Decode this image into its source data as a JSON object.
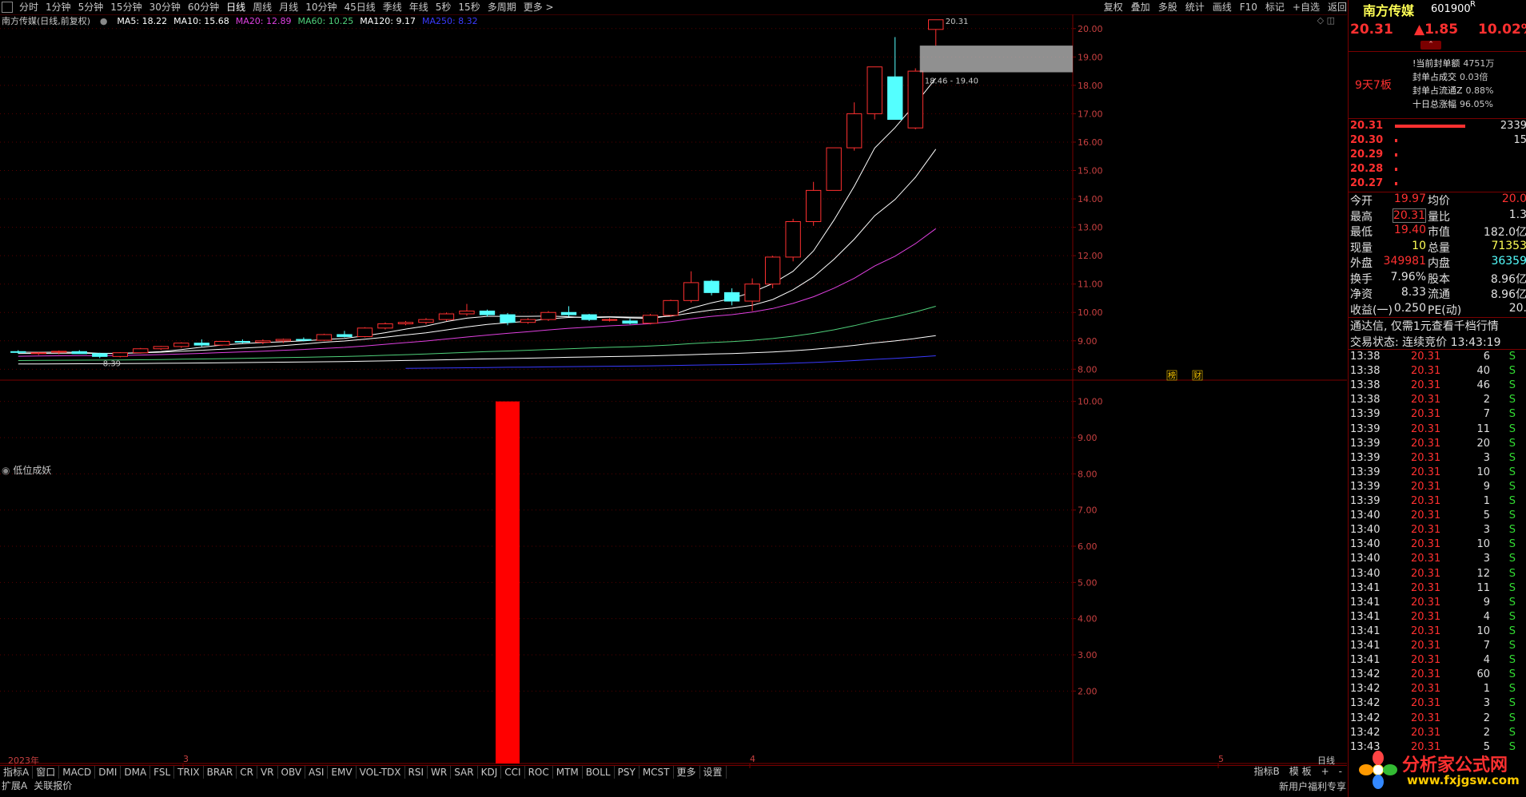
{
  "toolbar": {
    "periods": [
      "分时",
      "1分钟",
      "5分钟",
      "15分钟",
      "30分钟",
      "60分钟",
      "日线",
      "周线",
      "月线",
      "10分钟",
      "45日线",
      "季线",
      "年线",
      "5秒",
      "15秒",
      "多周期",
      "更多 >"
    ],
    "tools": [
      "复权",
      "叠加",
      "多股",
      "统计",
      "画线",
      "F10",
      "标记",
      "+自选",
      "返回"
    ]
  },
  "chart_header": {
    "title": "南方传媒(日线,前复权)",
    "ma": [
      {
        "label": "MA5: 18.22",
        "color": "#ffffff"
      },
      {
        "label": "MA10: 15.68",
        "color": "#ffffff"
      },
      {
        "label": "MA20: 12.89",
        "color": "#e040e0"
      },
      {
        "label": "MA60: 10.25",
        "color": "#4fd07a"
      },
      {
        "label": "MA120: 9.17",
        "color": "#ffffff"
      },
      {
        "label": "MA250: 8.32",
        "color": "#3a3aff"
      }
    ]
  },
  "chart_data": [
    {
      "type": "candlestick",
      "title": "南方传媒(日线,前复权)",
      "ylim": [
        7.7,
        20.5
      ],
      "yticks": [
        "20.00",
        "19.00",
        "18.00",
        "17.00",
        "16.00",
        "15.00",
        "14.00",
        "13.00",
        "12.00",
        "11.00",
        "10.00",
        "9.00",
        "8.00"
      ],
      "ohlc": [
        [
          8.62,
          8.67,
          8.55,
          8.6
        ],
        [
          8.55,
          8.6,
          8.5,
          8.58
        ],
        [
          8.6,
          8.66,
          8.52,
          8.63
        ],
        [
          8.62,
          8.67,
          8.55,
          8.55
        ],
        [
          8.55,
          8.58,
          8.39,
          8.45
        ],
        [
          8.45,
          8.6,
          8.42,
          8.58
        ],
        [
          8.58,
          8.75,
          8.55,
          8.72
        ],
        [
          8.72,
          8.82,
          8.68,
          8.8
        ],
        [
          8.8,
          8.95,
          8.75,
          8.92
        ],
        [
          8.92,
          9.05,
          8.8,
          8.85
        ],
        [
          8.85,
          9.0,
          8.82,
          8.98
        ],
        [
          8.98,
          9.05,
          8.9,
          8.95
        ],
        [
          8.95,
          9.05,
          8.88,
          9.0
        ],
        [
          9.0,
          9.08,
          8.92,
          9.05
        ],
        [
          9.05,
          9.12,
          8.98,
          9.02
        ],
        [
          9.02,
          9.25,
          9.0,
          9.22
        ],
        [
          9.22,
          9.35,
          9.12,
          9.15
        ],
        [
          9.15,
          9.48,
          9.12,
          9.45
        ],
        [
          9.45,
          9.65,
          9.4,
          9.6
        ],
        [
          9.6,
          9.7,
          9.55,
          9.65
        ],
        [
          9.65,
          9.8,
          9.58,
          9.75
        ],
        [
          9.75,
          10.0,
          9.7,
          9.95
        ],
        [
          9.95,
          10.3,
          9.88,
          10.05
        ],
        [
          10.05,
          10.1,
          9.85,
          9.92
        ],
        [
          9.92,
          9.98,
          9.55,
          9.65
        ],
        [
          9.65,
          9.8,
          9.6,
          9.75
        ],
        [
          9.75,
          10.05,
          9.7,
          10.0
        ],
        [
          10.0,
          10.22,
          9.85,
          9.92
        ],
        [
          9.92,
          9.95,
          9.7,
          9.75
        ],
        [
          9.75,
          9.8,
          9.68,
          9.75
        ],
        [
          9.7,
          9.78,
          9.58,
          9.62
        ],
        [
          9.62,
          9.95,
          9.58,
          9.9
        ],
        [
          9.9,
          10.45,
          9.85,
          10.42
        ],
        [
          10.42,
          11.45,
          10.35,
          11.05
        ],
        [
          11.1,
          11.15,
          10.6,
          10.7
        ],
        [
          10.7,
          10.85,
          10.25,
          10.4
        ],
        [
          10.4,
          11.2,
          10.05,
          11.0
        ],
        [
          11.0,
          12.0,
          10.85,
          11.95
        ],
        [
          11.95,
          13.3,
          11.8,
          13.2
        ],
        [
          13.2,
          14.6,
          13.05,
          14.3
        ],
        [
          14.3,
          15.8,
          14.3,
          15.8
        ],
        [
          15.8,
          17.4,
          15.7,
          17.0
        ],
        [
          17.0,
          18.65,
          16.8,
          18.65
        ],
        [
          18.3,
          19.7,
          16.8,
          16.8
        ],
        [
          16.5,
          18.6,
          16.45,
          18.5
        ],
        [
          19.97,
          20.31,
          19.4,
          20.31
        ]
      ],
      "annotations": [
        "8.39",
        "20.31",
        "18.46 - 19.40"
      ],
      "markers": [
        "榜",
        "财"
      ]
    },
    {
      "type": "bar",
      "title": "低位成妖",
      "ylim": [
        0,
        10.5
      ],
      "yticks": [
        "10.00",
        "9.00",
        "8.00",
        "7.00",
        "6.00",
        "5.00",
        "4.00",
        "3.00",
        "2.00"
      ],
      "signal_index": 24,
      "signal_value": 10,
      "color": "#ff0000"
    }
  ],
  "indicator_title": "低位成妖",
  "xaxis": {
    "year": "2023年",
    "m3": "3",
    "m4": "4",
    "m5": "5",
    "period": "日线"
  },
  "rpanel": {
    "name": "南方传媒",
    "code": "601900",
    "r": "R",
    "price": "20.31",
    "change": "▲1.85",
    "pct": "10.02%",
    "board": "9天7板",
    "seal": [
      {
        "k": "!当前封单额",
        "v": "4751万"
      },
      {
        "k": "封单占成交",
        "v": "0.03倍"
      },
      {
        "k": "封单占流通Z",
        "v": "0.88%"
      },
      {
        "k": "十日总涨幅",
        "v": "96.05%"
      }
    ],
    "asks": [
      {
        "p": "20.31",
        "v": "2339",
        "bar": true
      },
      {
        "p": "20.30",
        "v": "15"
      },
      {
        "p": "20.29",
        "v": ""
      },
      {
        "p": "20.28",
        "v": ""
      },
      {
        "p": "20.27",
        "v": ""
      }
    ],
    "quote": [
      {
        "l1": "今开",
        "v1": "19.97",
        "l2": "均价",
        "v2": "20.0"
      },
      {
        "l1": "最高",
        "v1": "20.31",
        "l2": "量比",
        "v2": "1.3"
      },
      {
        "l1": "最低",
        "v1": "19.40",
        "l2": "市值",
        "v2": "182.0亿"
      },
      {
        "l1": "现量",
        "v1": "10",
        "l2": "总量",
        "v2": "71353"
      },
      {
        "l1": "外盘",
        "v1": "349981",
        "l2": "内盘",
        "v2": "36359"
      },
      {
        "l1": "换手",
        "v1": "7.96%",
        "l2": "股本",
        "v2": "8.96亿"
      },
      {
        "l1": "净资",
        "v1": "8.33",
        "l2": "流通",
        "v2": "8.96亿"
      },
      {
        "l1": "收益(一)",
        "v1": "0.250",
        "l2": "PE(动)",
        "v2": "20."
      }
    ],
    "promo": "通达信, 仅需1元查看千档行情",
    "trade_state": "交易状态: 连续竞价 13:43:19",
    "ticks": [
      [
        "13:38",
        "20.31",
        "6"
      ],
      [
        "13:38",
        "20.31",
        "40"
      ],
      [
        "13:38",
        "20.31",
        "46"
      ],
      [
        "13:38",
        "20.31",
        "2"
      ],
      [
        "13:39",
        "20.31",
        "7"
      ],
      [
        "13:39",
        "20.31",
        "11"
      ],
      [
        "13:39",
        "20.31",
        "20"
      ],
      [
        "13:39",
        "20.31",
        "3"
      ],
      [
        "13:39",
        "20.31",
        "10"
      ],
      [
        "13:39",
        "20.31",
        "9"
      ],
      [
        "13:39",
        "20.31",
        "1"
      ],
      [
        "13:40",
        "20.31",
        "5"
      ],
      [
        "13:40",
        "20.31",
        "3"
      ],
      [
        "13:40",
        "20.31",
        "10"
      ],
      [
        "13:40",
        "20.31",
        "3"
      ],
      [
        "13:40",
        "20.31",
        "12"
      ],
      [
        "13:41",
        "20.31",
        "11"
      ],
      [
        "13:41",
        "20.31",
        "9"
      ],
      [
        "13:41",
        "20.31",
        "4"
      ],
      [
        "13:41",
        "20.31",
        "10"
      ],
      [
        "13:41",
        "20.31",
        "7"
      ],
      [
        "13:41",
        "20.31",
        "4"
      ],
      [
        "13:42",
        "20.31",
        "60"
      ],
      [
        "13:42",
        "20.31",
        "1"
      ],
      [
        "13:42",
        "20.31",
        "3"
      ],
      [
        "13:42",
        "20.31",
        "2"
      ],
      [
        "13:42",
        "20.31",
        "2"
      ],
      [
        "13:43",
        "20.31",
        "5"
      ]
    ],
    "tick_side": "S"
  },
  "bottom": {
    "tabs": [
      "指标A",
      "窗口",
      "MACD",
      "DMI",
      "DMA",
      "FSL",
      "TRIX",
      "BRAR",
      "CR",
      "VR",
      "OBV",
      "ASI",
      "EMV",
      "VOL-TDX",
      "RSI",
      "WR",
      "SAR",
      "KDJ",
      "CCI",
      "ROC",
      "MTM",
      "BOLL",
      "PSY",
      "MCST",
      "更多",
      "设置"
    ],
    "right_tabs": [
      "指标B",
      "模 板",
      "+",
      "-"
    ],
    "status": [
      "扩展A",
      "关联报价"
    ],
    "status_right": "新用户福利专享"
  },
  "watermark": {
    "text": "分析家公式网",
    "url": "www.fxjgsw.com"
  },
  "colors": {
    "up": "#ff3030",
    "down": "#54ffff",
    "bg": "#000000",
    "grid": "#7a0000"
  }
}
